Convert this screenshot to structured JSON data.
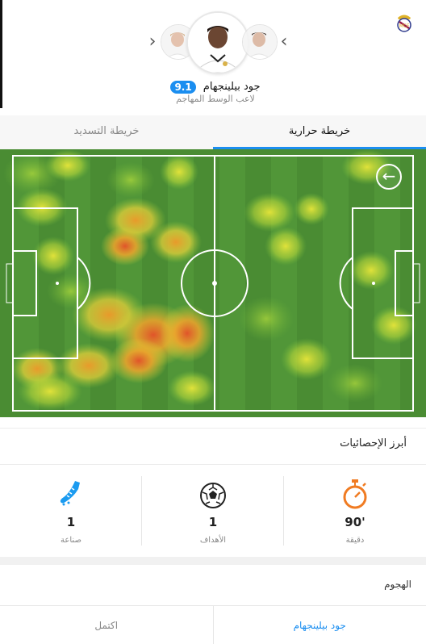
{
  "header": {
    "player_name": "جود بيلينجهام",
    "rating": "9.1",
    "position": "لاعب الوسط المهاجم",
    "icons": {
      "club": "club-crest-icon",
      "prev": "chevron-left-icon",
      "next": "chevron-right-icon"
    }
  },
  "tabs": [
    {
      "label": "خريطة حرارية",
      "active": true
    },
    {
      "label": "خريطة التسديد",
      "active": false
    }
  ],
  "pitch": {
    "back_icon": "arrow-left-circle-icon"
  },
  "stats": {
    "title": "أبرز الإحصائيات",
    "items": [
      {
        "value": "'90",
        "label": "دقيقة",
        "icon": "stopwatch-icon",
        "color": "#f07b22"
      },
      {
        "value": "1",
        "label": "الأهداف",
        "icon": "football-icon",
        "color": "#222222"
      },
      {
        "value": "1",
        "label": "صناعة",
        "icon": "boot-icon",
        "color": "#1b9bf0"
      }
    ]
  },
  "attack": {
    "title": "الهجوم"
  },
  "bottom_tabs": [
    {
      "label": "جود بيلينجهام",
      "active": true
    },
    {
      "label": "اكتمل",
      "active": false
    }
  ],
  "colors": {
    "accent": "#1b8ef0",
    "pitch": "#4d8f34"
  }
}
